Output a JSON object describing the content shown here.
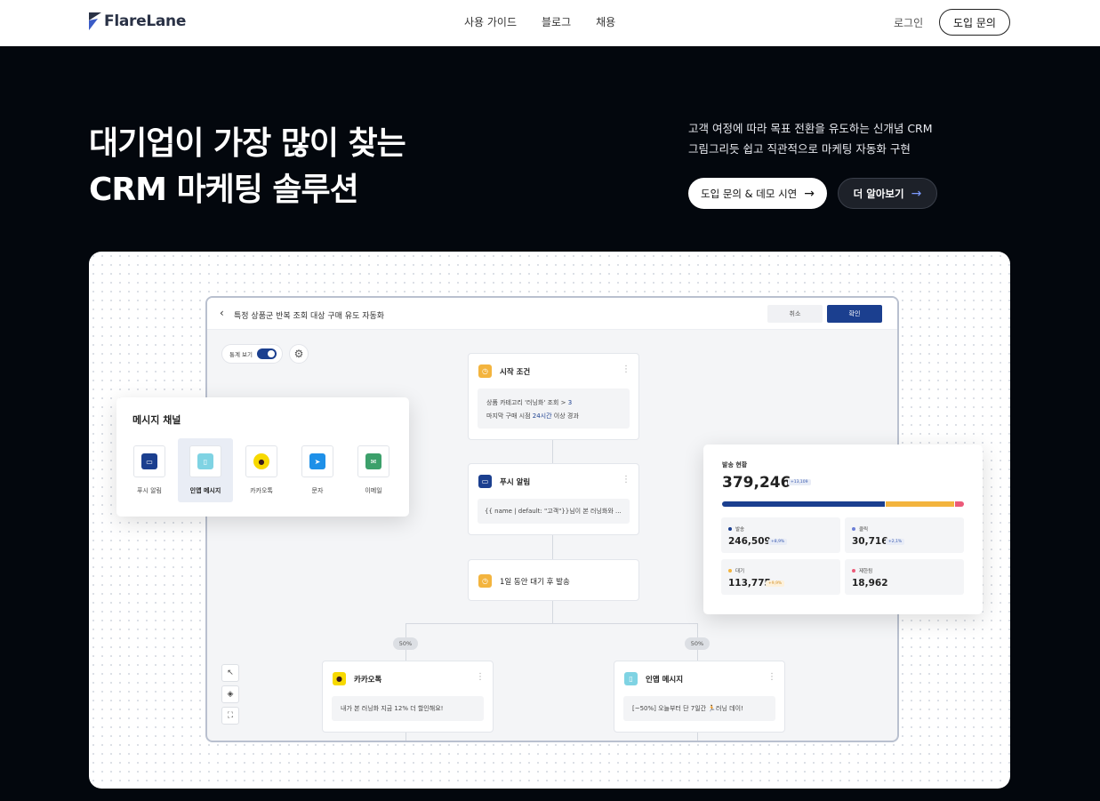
{
  "brand": {
    "name": "FlareLane"
  },
  "nav": [
    "사용 가이드",
    "블로그",
    "채용"
  ],
  "header": {
    "login": "로그인",
    "inquiry": "도입 문의"
  },
  "hero": {
    "title_line1": "대기업이 가장 많이 찾는",
    "title_line2": "CRM 마케팅 솔루션",
    "desc_line1": "고객 여정에 따라 목표 전환을 유도하는 신개념 CRM",
    "desc_line2": "그림그리듯 쉽고 직관적으로 마케팅 자동화 구현",
    "cta_primary": "도입 문의 & 데모 시연",
    "cta_secondary": "더 알아보기"
  },
  "editor": {
    "title": "특정 상품군 반복 조회 대상 구매 유도 자동화",
    "cancel": "취소",
    "confirm": "확인",
    "stat_toggle": "통계 보기",
    "start_node": {
      "title": "시작 조건",
      "line1_pre": "상품 카테고리 '러닝화' 조회 > ",
      "line1_val": "3",
      "line2_pre": "마지막 구매 시점 ",
      "line2_val": "24시간",
      "line2_post": " 이상 경과"
    },
    "push_node": {
      "title": "푸시 알림",
      "body": "{{ name | default: \"고객\"}}님이 본 러닝화와 ..."
    },
    "wait_node": {
      "title": "1일 동안 대기 후 발송"
    },
    "split": {
      "left": "50%",
      "right": "50%"
    },
    "kakao_node": {
      "title": "카카오톡",
      "body": "내가 본 러닝화 지금 12% 더 할인해요!"
    },
    "inapp_node": {
      "title": "인앱 메시지",
      "body": "[~50%] 오늘부터 단 7일간 🏃러닝 데이!"
    }
  },
  "channels": {
    "title": "메시지 채널",
    "items": [
      {
        "label": "푸시 알림",
        "color": "#1b3f8f"
      },
      {
        "label": "인앱 메시지",
        "color": "#7fd3e3"
      },
      {
        "label": "카카오톡",
        "color": "#f7d900"
      },
      {
        "label": "문자",
        "color": "#1e90e8"
      },
      {
        "label": "이메일",
        "color": "#3ca06b"
      }
    ]
  },
  "stats": {
    "label": "발송 현황",
    "total": "379,246",
    "total_badge": "+13,109",
    "items": [
      {
        "name": "발송",
        "value": "246,509",
        "color": "#1b3f8f",
        "badge": "+8,9%"
      },
      {
        "name": "클릭",
        "value": "30,716",
        "color": "#6d7fd6",
        "badge": "+2,1%"
      },
      {
        "name": "대기",
        "value": "113,775",
        "color": "#f3b43e",
        "badge": "+9,9%"
      },
      {
        "name": "제한됨",
        "value": "18,962",
        "color": "#ec5a79"
      }
    ]
  }
}
